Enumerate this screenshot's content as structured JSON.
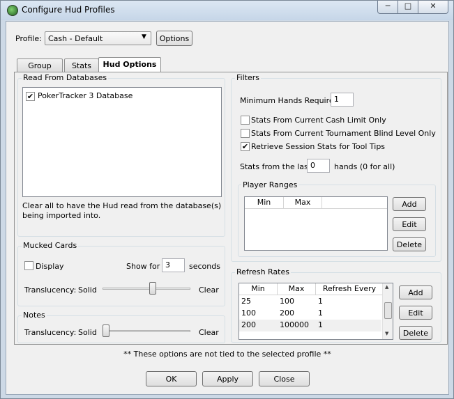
{
  "window": {
    "title": "Configure Hud Profiles"
  },
  "profile": {
    "label": "Profile:",
    "selected": "Cash - Default",
    "options_button": "Options"
  },
  "tabs": [
    {
      "label": "Group"
    },
    {
      "label": "Stats"
    },
    {
      "label": "Hud Options"
    }
  ],
  "databases": {
    "title": "Read From Databases",
    "items": [
      {
        "label": "PokerTracker 3 Database",
        "checked": true
      }
    ],
    "note": "Clear all to have the Hud read from the database(s) being imported into."
  },
  "mucked": {
    "title": "Mucked Cards",
    "display_label": "Display",
    "display_checked": false,
    "show_for_label": "Show for",
    "show_for_value": "3",
    "seconds_label": "seconds",
    "translucency_label": "Translucency:",
    "solid_label": "Solid",
    "clear_label": "Clear",
    "slider_level": 0.58
  },
  "notes": {
    "title": "Notes",
    "translucency_label": "Translucency:",
    "solid_label": "Solid",
    "clear_label": "Clear",
    "slider_level": 0.0
  },
  "filters": {
    "title": "Filters",
    "min_hands_label": "Minimum Hands Required:",
    "min_hands_value": "1",
    "cb1": {
      "label": "Stats From Current Cash Limit Only",
      "checked": false
    },
    "cb2": {
      "label": "Stats From Current Tournament Blind Level Only",
      "checked": false
    },
    "cb3": {
      "label": "Retrieve Session Stats for Tool Tips",
      "checked": true
    },
    "last_label": "Stats from the last",
    "last_value": "0",
    "last_suffix": "hands (0 for all)"
  },
  "player_ranges": {
    "title": "Player Ranges",
    "columns": [
      "Min",
      "Max",
      ""
    ],
    "add": "Add",
    "edit": "Edit",
    "delete": "Delete"
  },
  "refresh_rates": {
    "title": "Refresh Rates",
    "columns": [
      "Min",
      "Max",
      "Refresh Every"
    ],
    "rows": [
      [
        "25",
        "100",
        "1"
      ],
      [
        "100",
        "200",
        "1"
      ],
      [
        "200",
        "100000",
        "1"
      ]
    ],
    "add": "Add",
    "edit": "Edit",
    "delete": "Delete"
  },
  "footer": {
    "note": "** These options are not tied to the selected profile **",
    "ok": "OK",
    "apply": "Apply",
    "close": "Close"
  },
  "colors": {
    "titlebar": "#c6d6e8",
    "dialog": "#f0f0f0",
    "selected_row": "#f0f0f0"
  }
}
